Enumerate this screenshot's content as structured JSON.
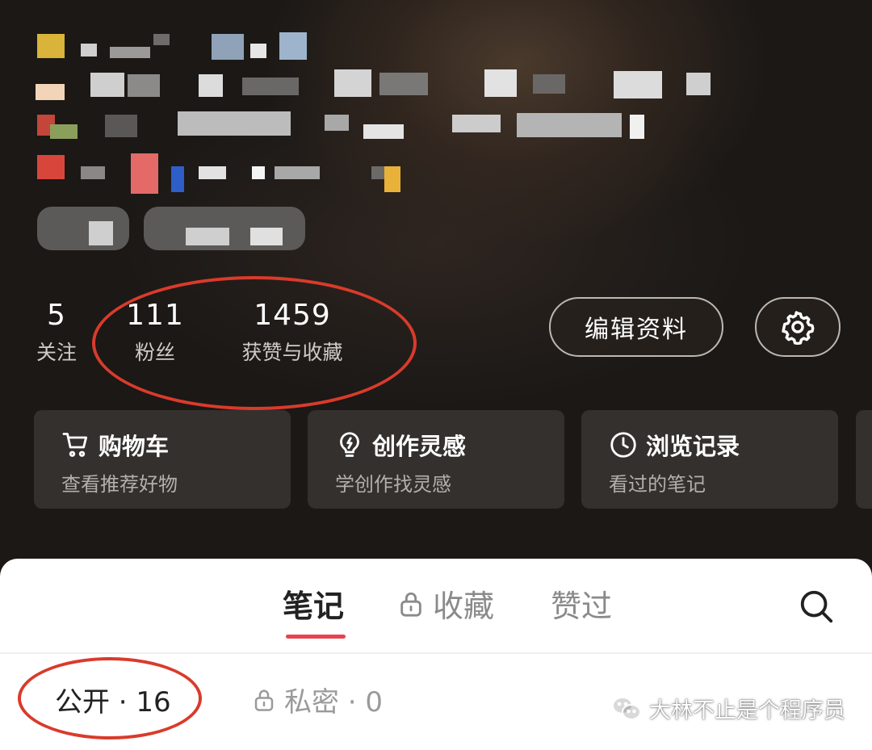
{
  "profile": {
    "stats": [
      {
        "value": "5",
        "label": "关注"
      },
      {
        "value": "111",
        "label": "粉丝"
      },
      {
        "value": "1459",
        "label": "获赞与收藏"
      }
    ],
    "edit_label": "编辑资料"
  },
  "shortcuts": [
    {
      "title": "购物车",
      "subtitle": "查看推荐好物",
      "icon": "cart-icon"
    },
    {
      "title": "创作灵感",
      "subtitle": "学创作找灵感",
      "icon": "lightbulb-icon"
    },
    {
      "title": "浏览记录",
      "subtitle": "看过的笔记",
      "icon": "clock-icon"
    }
  ],
  "tabs": {
    "notes": "笔记",
    "favorites": "收藏",
    "liked": "赞过"
  },
  "filters": {
    "public": "公开 · 16",
    "private": "私密 · 0"
  },
  "watermark": "大林不止是个程序员",
  "colors": {
    "accent": "#e8424f",
    "annotation": "#d93b2b"
  }
}
